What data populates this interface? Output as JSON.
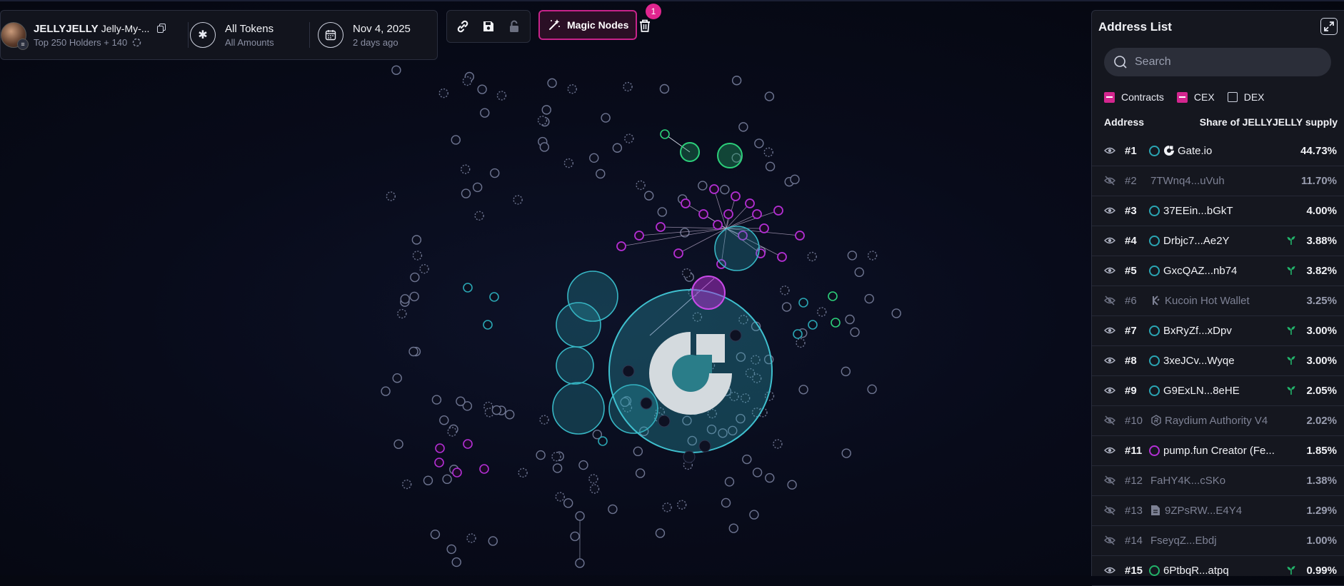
{
  "token": {
    "symbol": "JELLYJELLY",
    "name": "Jelly-My-...",
    "holders_summary": "Top 250 Holders + 140",
    "avatar_badge": "≡"
  },
  "filter": {
    "title": "All Tokens",
    "subtitle": "All Amounts"
  },
  "date": {
    "title": "Nov 4, 2025",
    "subtitle": "2 days ago"
  },
  "toolbar": {
    "magic_label": "Magic Nodes",
    "magic_count": "1"
  },
  "address_panel": {
    "title": "Address List",
    "search_placeholder": "Search",
    "filters": [
      {
        "label": "Contracts",
        "checked": true
      },
      {
        "label": "CEX",
        "checked": true
      },
      {
        "label": "DEX",
        "checked": false
      }
    ],
    "col_address": "Address",
    "col_share": "Share of JELLYJELLY supply",
    "rows": [
      {
        "rank": "#1",
        "label": "Gate.io",
        "pct": "44.73%",
        "visible": true,
        "icon": "gate-logo-icon",
        "dot": "teal",
        "sprout": false
      },
      {
        "rank": "#2",
        "label": "7TWnq4...uVuh",
        "pct": "11.70%",
        "visible": false,
        "icon": "",
        "dot": "",
        "sprout": false
      },
      {
        "rank": "#3",
        "label": "37EEin...bGkT",
        "pct": "4.00%",
        "visible": true,
        "icon": "",
        "dot": "teal",
        "sprout": false
      },
      {
        "rank": "#4",
        "label": "Drbjc7...Ae2Y",
        "pct": "3.88%",
        "visible": true,
        "icon": "",
        "dot": "teal",
        "sprout": true
      },
      {
        "rank": "#5",
        "label": "GxcQAZ...nb74",
        "pct": "3.82%",
        "visible": true,
        "icon": "",
        "dot": "teal",
        "sprout": true
      },
      {
        "rank": "#6",
        "label": "Kucoin Hot Wallet",
        "pct": "3.25%",
        "visible": false,
        "icon": "kucoin-logo-icon",
        "dot": "",
        "sprout": false
      },
      {
        "rank": "#7",
        "label": "BxRyZf...xDpv",
        "pct": "3.00%",
        "visible": true,
        "icon": "",
        "dot": "teal",
        "sprout": true
      },
      {
        "rank": "#8",
        "label": "3xeJCv...Wyqe",
        "pct": "3.00%",
        "visible": true,
        "icon": "",
        "dot": "teal",
        "sprout": true
      },
      {
        "rank": "#9",
        "label": "G9ExLN...8eHE",
        "pct": "2.05%",
        "visible": true,
        "icon": "",
        "dot": "teal",
        "sprout": true
      },
      {
        "rank": "#10",
        "label": "Raydium Authority V4",
        "pct": "2.02%",
        "visible": false,
        "icon": "raydium-logo-icon",
        "dot": "",
        "sprout": false
      },
      {
        "rank": "#11",
        "label": "pump.fun Creator (Fe...",
        "pct": "1.85%",
        "visible": true,
        "icon": "",
        "dot": "purple",
        "sprout": false
      },
      {
        "rank": "#12",
        "label": "FaHY4K...cSKo",
        "pct": "1.38%",
        "visible": false,
        "icon": "",
        "dot": "",
        "sprout": false
      },
      {
        "rank": "#13",
        "label": "9ZPsRW...E4Y4",
        "pct": "1.29%",
        "visible": false,
        "icon": "document-icon",
        "dot": "",
        "sprout": false
      },
      {
        "rank": "#14",
        "label": "FseyqZ...Ebdj",
        "pct": "1.00%",
        "visible": false,
        "icon": "",
        "dot": "",
        "sprout": false
      },
      {
        "rank": "#15",
        "label": "6PtbqR...atpq",
        "pct": "0.99%",
        "visible": true,
        "icon": "",
        "dot": "green",
        "sprout": true
      }
    ]
  },
  "colors": {
    "accent": "#d4268f",
    "teal": "#2aa5b3",
    "purple": "#b32fd4",
    "green": "#22b36a",
    "node": "#6d7490",
    "background": "#080b1a"
  }
}
